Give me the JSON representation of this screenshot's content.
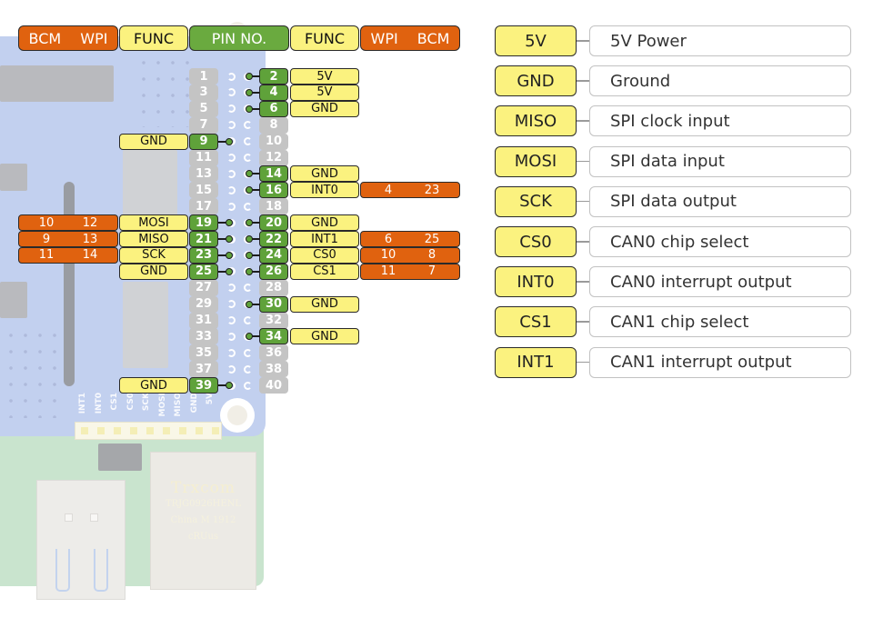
{
  "header": {
    "left_gpio": [
      "BCM",
      "WPI"
    ],
    "left_func": "FUNC",
    "pin_no": "PIN NO.",
    "right_func": "FUNC",
    "right_gpio": [
      "WPI",
      "BCM"
    ]
  },
  "colors": {
    "gpio_orange": "#e0620f",
    "func_yellow": "#fbf27f",
    "pin_green": "#5fa23a",
    "pin_gray": "#c4c4c4",
    "board_blue": "#9db3e6",
    "board_green": "#a8d3b0"
  },
  "pins": [
    {
      "odd": "1",
      "odd_used": false,
      "even": "2",
      "even_used": true,
      "even_func": "5V"
    },
    {
      "odd": "3",
      "odd_used": false,
      "even": "4",
      "even_used": true,
      "even_func": "5V"
    },
    {
      "odd": "5",
      "odd_used": false,
      "even": "6",
      "even_used": true,
      "even_func": "GND"
    },
    {
      "odd": "7",
      "odd_used": false,
      "even": "8",
      "even_used": false
    },
    {
      "odd": "9",
      "odd_used": true,
      "odd_func": "GND",
      "even": "10",
      "even_used": false
    },
    {
      "odd": "11",
      "odd_used": false,
      "even": "12",
      "even_used": false
    },
    {
      "odd": "13",
      "odd_used": false,
      "even": "14",
      "even_used": true,
      "even_func": "GND"
    },
    {
      "odd": "15",
      "odd_used": false,
      "even": "16",
      "even_used": true,
      "even_func": "INT0",
      "even_wpi": "4",
      "even_bcm": "23"
    },
    {
      "odd": "17",
      "odd_used": false,
      "even": "18",
      "even_used": false
    },
    {
      "odd": "19",
      "odd_used": true,
      "odd_func": "MOSI",
      "odd_bcm": "10",
      "odd_wpi": "12",
      "even": "20",
      "even_used": true,
      "even_func": "GND"
    },
    {
      "odd": "21",
      "odd_used": true,
      "odd_func": "MISO",
      "odd_bcm": "9",
      "odd_wpi": "13",
      "even": "22",
      "even_used": true,
      "even_func": "INT1",
      "even_wpi": "6",
      "even_bcm": "25"
    },
    {
      "odd": "23",
      "odd_used": true,
      "odd_func": "SCK",
      "odd_bcm": "11",
      "odd_wpi": "14",
      "even": "24",
      "even_used": true,
      "even_func": "CS0",
      "even_wpi": "10",
      "even_bcm": "8"
    },
    {
      "odd": "25",
      "odd_used": true,
      "odd_func": "GND",
      "even": "26",
      "even_used": true,
      "even_func": "CS1",
      "even_wpi": "11",
      "even_bcm": "7"
    },
    {
      "odd": "27",
      "odd_used": false,
      "even": "28",
      "even_used": false
    },
    {
      "odd": "29",
      "odd_used": false,
      "even": "30",
      "even_used": true,
      "even_func": "GND"
    },
    {
      "odd": "31",
      "odd_used": false,
      "even": "32",
      "even_used": false
    },
    {
      "odd": "33",
      "odd_used": false,
      "even": "34",
      "even_used": true,
      "even_func": "GND"
    },
    {
      "odd": "35",
      "odd_used": false,
      "even": "36",
      "even_used": false
    },
    {
      "odd": "37",
      "odd_used": false,
      "even": "38",
      "even_used": false
    },
    {
      "odd": "39",
      "odd_used": true,
      "odd_func": "GND",
      "even": "40",
      "even_used": false
    }
  ],
  "board": {
    "silkscreen_labels": [
      "INT1",
      "INT0",
      "CS1",
      "CS0",
      "SCK",
      "MOSI",
      "MISO",
      "GND",
      "5V"
    ],
    "ethernet_brand": "Trxcom",
    "ethernet_model": "TRJG0926HENL",
    "ethernet_origin": "China M 1912",
    "ethernet_cert": "cRUus"
  },
  "legend": [
    {
      "key": "5V",
      "desc": "5V Power"
    },
    {
      "key": "GND",
      "desc": "Ground"
    },
    {
      "key": "MISO",
      "desc": "SPI clock input"
    },
    {
      "key": "MOSI",
      "desc": "SPI data input"
    },
    {
      "key": "SCK",
      "desc": "SPI data output"
    },
    {
      "key": "CS0",
      "desc": "CAN0 chip select"
    },
    {
      "key": "INT0",
      "desc": "CAN0 interrupt output"
    },
    {
      "key": "CS1",
      "desc": "CAN1 chip select"
    },
    {
      "key": "INT1",
      "desc": "CAN1 interrupt output"
    }
  ]
}
